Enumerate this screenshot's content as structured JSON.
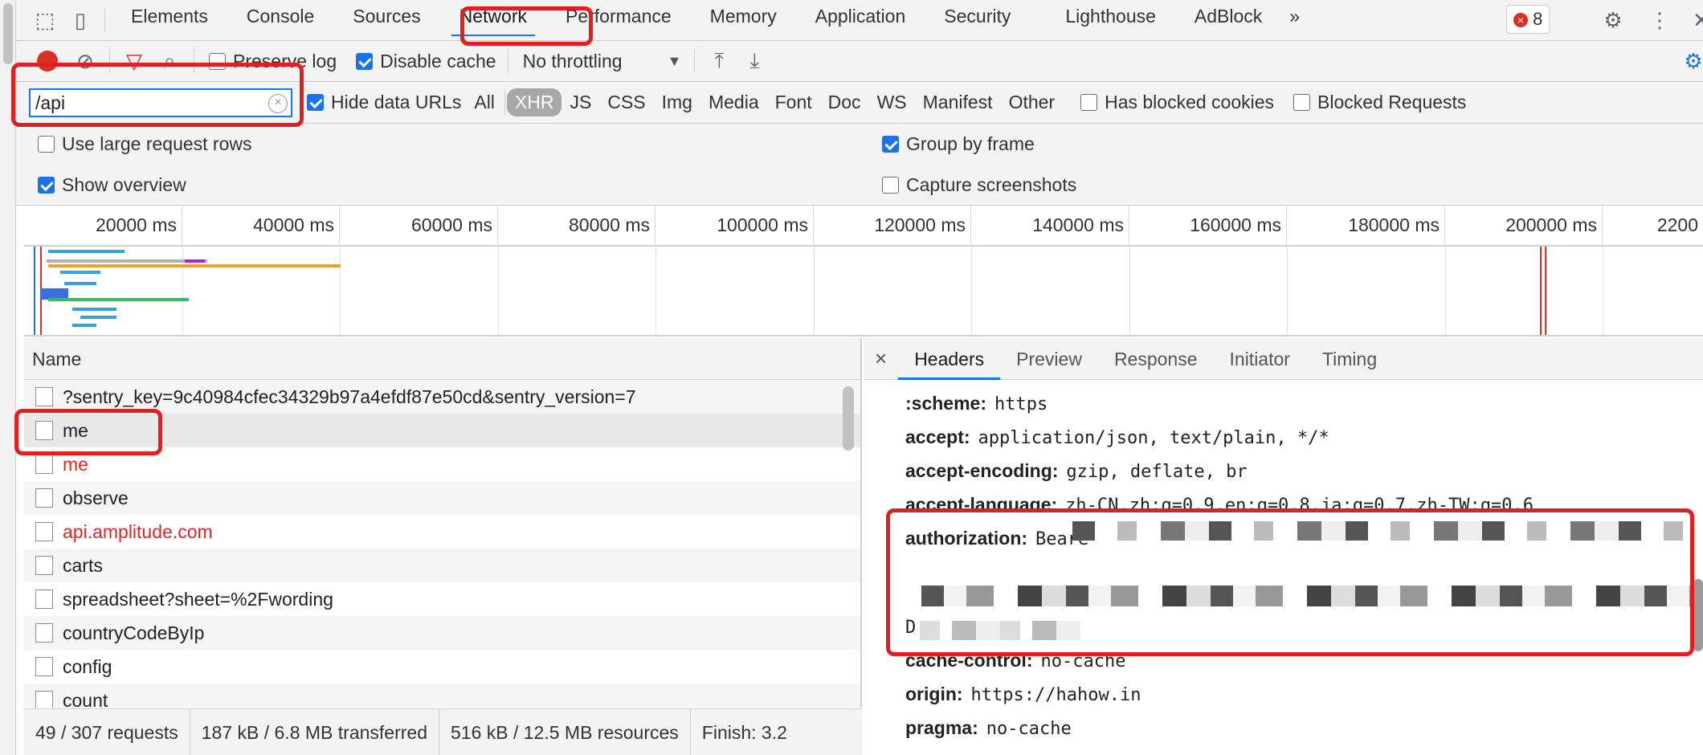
{
  "toolbar": {
    "tabs": [
      "Elements",
      "Console",
      "Sources",
      "Network",
      "Performance",
      "Memory",
      "Application",
      "Security",
      "Lighthouse",
      "AdBlock"
    ],
    "more": "»",
    "error_count": "8"
  },
  "network_toolbar": {
    "preserve_log": "Preserve log",
    "disable_cache": "Disable cache",
    "throttling": "No throttling"
  },
  "filter": {
    "value": "/api",
    "hide_data_urls": "Hide data URLs",
    "types": [
      "All",
      "XHR",
      "JS",
      "CSS",
      "Img",
      "Media",
      "Font",
      "Doc",
      "WS",
      "Manifest",
      "Other"
    ],
    "has_blocked_cookies": "Has blocked cookies",
    "blocked_requests": "Blocked Requests"
  },
  "options": {
    "large_rows": "Use large request rows",
    "group_by_frame": "Group by frame",
    "show_overview": "Show overview",
    "capture_screenshots": "Capture screenshots"
  },
  "timeline": {
    "ticks": [
      "20000 ms",
      "40000 ms",
      "60000 ms",
      "80000 ms",
      "100000 ms",
      "120000 ms",
      "140000 ms",
      "160000 ms",
      "180000 ms",
      "200000 ms",
      "2200"
    ]
  },
  "requests": {
    "header": "Name",
    "rows": [
      {
        "name": "?sentry_key=9c40984cfec34329b97a4efdf87e50cd&sentry_version=7",
        "error": false
      },
      {
        "name": "me",
        "error": false
      },
      {
        "name": "me",
        "error": true
      },
      {
        "name": "observe",
        "error": false
      },
      {
        "name": "api.amplitude.com",
        "error": true
      },
      {
        "name": "carts",
        "error": false
      },
      {
        "name": "spreadsheet?sheet=%2Fwording",
        "error": false
      },
      {
        "name": "countryCodeByIp",
        "error": false
      },
      {
        "name": "config",
        "error": false
      },
      {
        "name": "count",
        "error": false
      }
    ]
  },
  "status_bar": {
    "requests": "49 / 307 requests",
    "transferred": "187 kB / 6.8 MB transferred",
    "resources": "516 kB / 12.5 MB resources",
    "finish": "Finish: 3.2"
  },
  "detail": {
    "close": "×",
    "tabs": [
      "Headers",
      "Preview",
      "Response",
      "Initiator",
      "Timing"
    ],
    "headers": [
      {
        "key": ":scheme:",
        "value": "https"
      },
      {
        "key": "accept:",
        "value": "application/json, text/plain, */*"
      },
      {
        "key": "accept-encoding:",
        "value": "gzip, deflate, br"
      },
      {
        "key": "accept-language:",
        "value": "zh-CN,zh;q=0.9,en;q=0.8,ja;q=0.7,zh-TW;q=0.6"
      },
      {
        "key": "authorization:",
        "value": "Beare"
      },
      {
        "key": "cache-control:",
        "value": "no-cache"
      },
      {
        "key": "origin:",
        "value": "https://hahow.in"
      },
      {
        "key": "pragma:",
        "value": "no-cache"
      }
    ],
    "auth_tail": "D"
  }
}
